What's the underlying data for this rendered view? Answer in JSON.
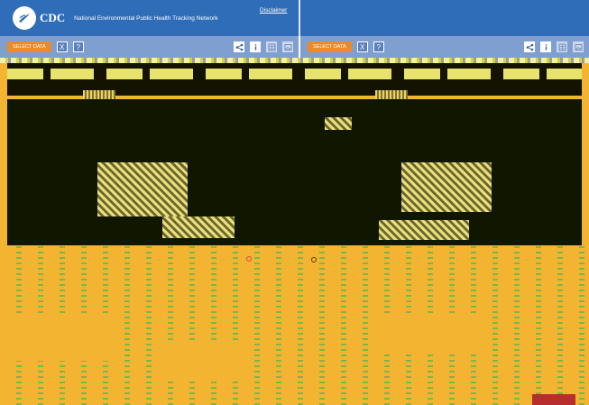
{
  "header": {
    "cdc_mark": "CDC",
    "site_title": "National Environmental Public Health Tracking Network",
    "disclaimer_link": "Disclaimer"
  },
  "toolbars": [
    {
      "select_data_label": "SELECT DATA",
      "close_label": "X",
      "help_label": "?",
      "icons": [
        "share-icon",
        "info-icon",
        "table-icon",
        "image-icon"
      ]
    },
    {
      "select_data_label": "SELECT DATA",
      "close_label": "X",
      "help_label": "?",
      "icons": [
        "share-icon",
        "info-icon",
        "table-icon",
        "image-icon"
      ]
    }
  ],
  "colors": {
    "header_blue": "#2f6db8",
    "toolbar_blue": "#7f9fd1",
    "select_orange": "#e98b2d",
    "map_orange": "#f3b531",
    "dark_band": "#131300",
    "green_counties": "#77b84b",
    "badge_red": "#b82d2d"
  }
}
